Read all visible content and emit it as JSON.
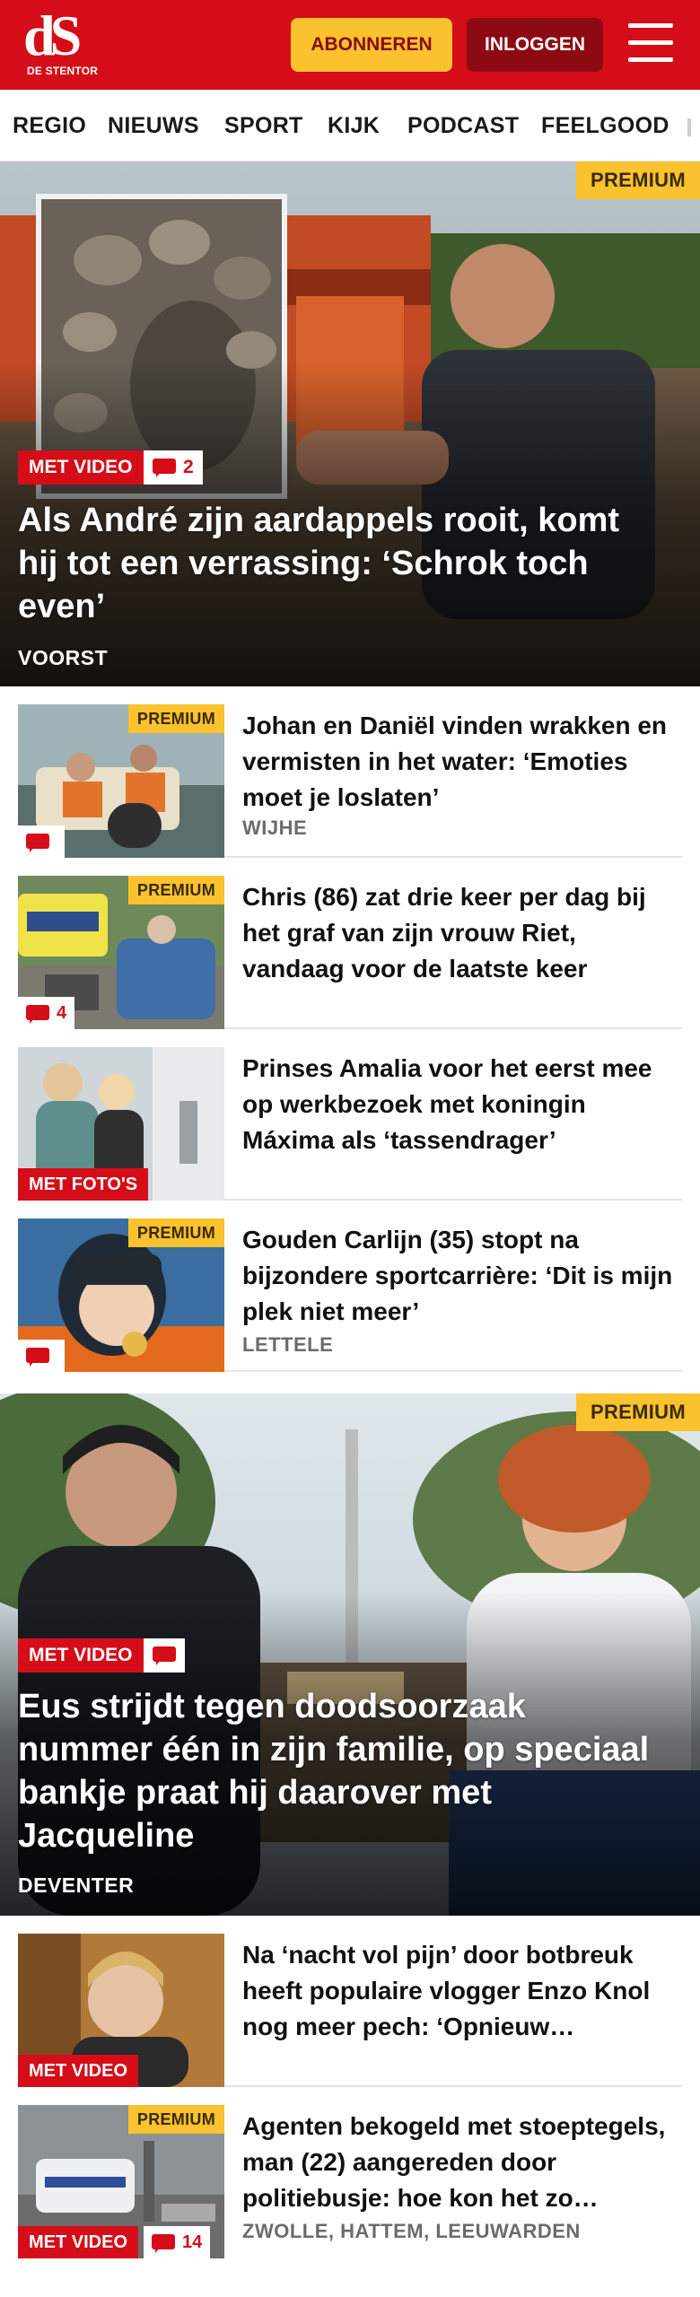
{
  "header": {
    "logo_text": "dS",
    "logo_name": "DE STENTOR",
    "subscribe_label": "ABONNEREN",
    "login_label": "INLOGGEN",
    "menu_icon": "hamburger-icon"
  },
  "nav": {
    "items": [
      "REGIO",
      "NIEUWS",
      "SPORT",
      "KIJK",
      "PODCAST",
      "FEELGOOD"
    ]
  },
  "colors": {
    "brand_red": "#d50d18",
    "premium_yellow": "#f9c22e",
    "login_dark_red": "#8c0b12"
  },
  "hero1": {
    "premium": "PREMIUM",
    "badge": "MET VIDEO",
    "comments": "2",
    "title": "Als André zijn aardappels rooit, komt hij tot een verrassing: ‘Schrok toch even’",
    "location": "VOORST"
  },
  "articles": [
    {
      "premium": "PREMIUM",
      "title": "Johan en Daniël vinden wrakken en vermisten in het water: ‘Emoties moet je loslaten’",
      "location": "WIJHE",
      "comments": ""
    },
    {
      "premium": "PREMIUM",
      "title": "Chris (86) zat drie keer per dag bij het graf van zijn vrouw Riet, vandaag voor de laatste keer",
      "location": "",
      "comments": "4"
    },
    {
      "badge": "MET FOTO'S",
      "title": "Prinses Amalia voor het eerst mee op werkbezoek met koningin Máxima als ‘tassendrager’",
      "location": ""
    },
    {
      "premium": "PREMIUM",
      "title": "Gouden Carlijn (35) stopt na bijzondere sportcarrière: ‘Dit is mijn plek niet meer’",
      "location": "LETTELE",
      "comments": ""
    }
  ],
  "hero2": {
    "premium": "PREMIUM",
    "badge": "MET VIDEO",
    "title": "Eus strijdt tegen doodsoorzaak nummer één in zijn familie, op speciaal bankje praat hij daarover met Jacqueline",
    "location": "DEVENTER"
  },
  "articles2": [
    {
      "badge": "MET VIDEO",
      "title": "Na ‘nacht vol pijn’ door botbreuk heeft populaire vlogger Enzo Knol nog meer pech: ‘Opnieuw…",
      "location": ""
    },
    {
      "premium": "PREMIUM",
      "badge": "MET VIDEO",
      "comments": "14",
      "title": "Agenten bekogeld met stoeptegels, man (22) aangereden door politiebusje: hoe kon het zo…",
      "location": "ZWOLLE, HATTEM, LEEUWARDEN"
    }
  ]
}
